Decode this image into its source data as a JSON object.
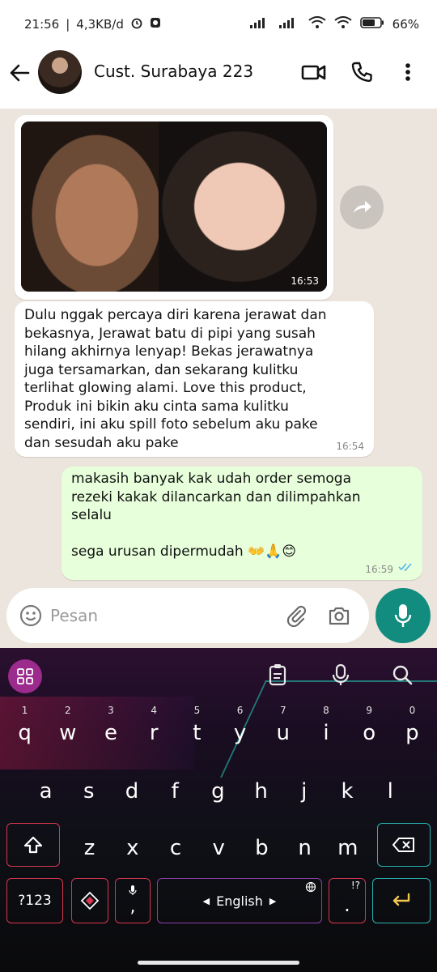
{
  "status_bar": {
    "time": "21:56",
    "speed": "4,3KB/d",
    "battery": "66%"
  },
  "header": {
    "contact_name": "Cust. Surabaya 223"
  },
  "messages": {
    "image_time": "16:53",
    "text1": "Dulu nggak percaya diri karena jerawat dan\nbekasnya, Jerawat batu di pipi yang susah\nhilang akhirnya lenyap! Bekas jerawatnya\njuga tersamarkan, dan sekarang kulitku\nterlihat glowing alami. Love this product,\nProduk ini bikin aku cinta sama kulitku\nsendiri, ini aku spill foto sebelum aku pake\ndan sesudah aku pake",
    "text1_time": "16:54",
    "reply": "makasih banyak kak udah order semoga\nrezeki kakak dilancarkan dan dilimpahkan\nselalu\n\nsega urusan dipermudah 👐🙏😊",
    "reply_time": "16:59"
  },
  "input": {
    "placeholder": "Pesan"
  },
  "keyboard": {
    "row1": [
      "q",
      "w",
      "e",
      "r",
      "t",
      "y",
      "u",
      "i",
      "o",
      "p"
    ],
    "row1_hints": [
      "1",
      "2",
      "3",
      "4",
      "5",
      "6",
      "7",
      "8",
      "9",
      "0"
    ],
    "row2": [
      "a",
      "s",
      "d",
      "f",
      "g",
      "h",
      "j",
      "k",
      "l"
    ],
    "row3": [
      "z",
      "x",
      "c",
      "v",
      "b",
      "n",
      "m"
    ],
    "symbols_label": "?123",
    "comma": ",",
    "period": ".",
    "period_hint": "!?",
    "space_label": "English"
  },
  "colors": {
    "accent": "#128c7e",
    "outgoing_bubble": "#e7ffdb",
    "read_ticks": "#4fb6ec"
  }
}
